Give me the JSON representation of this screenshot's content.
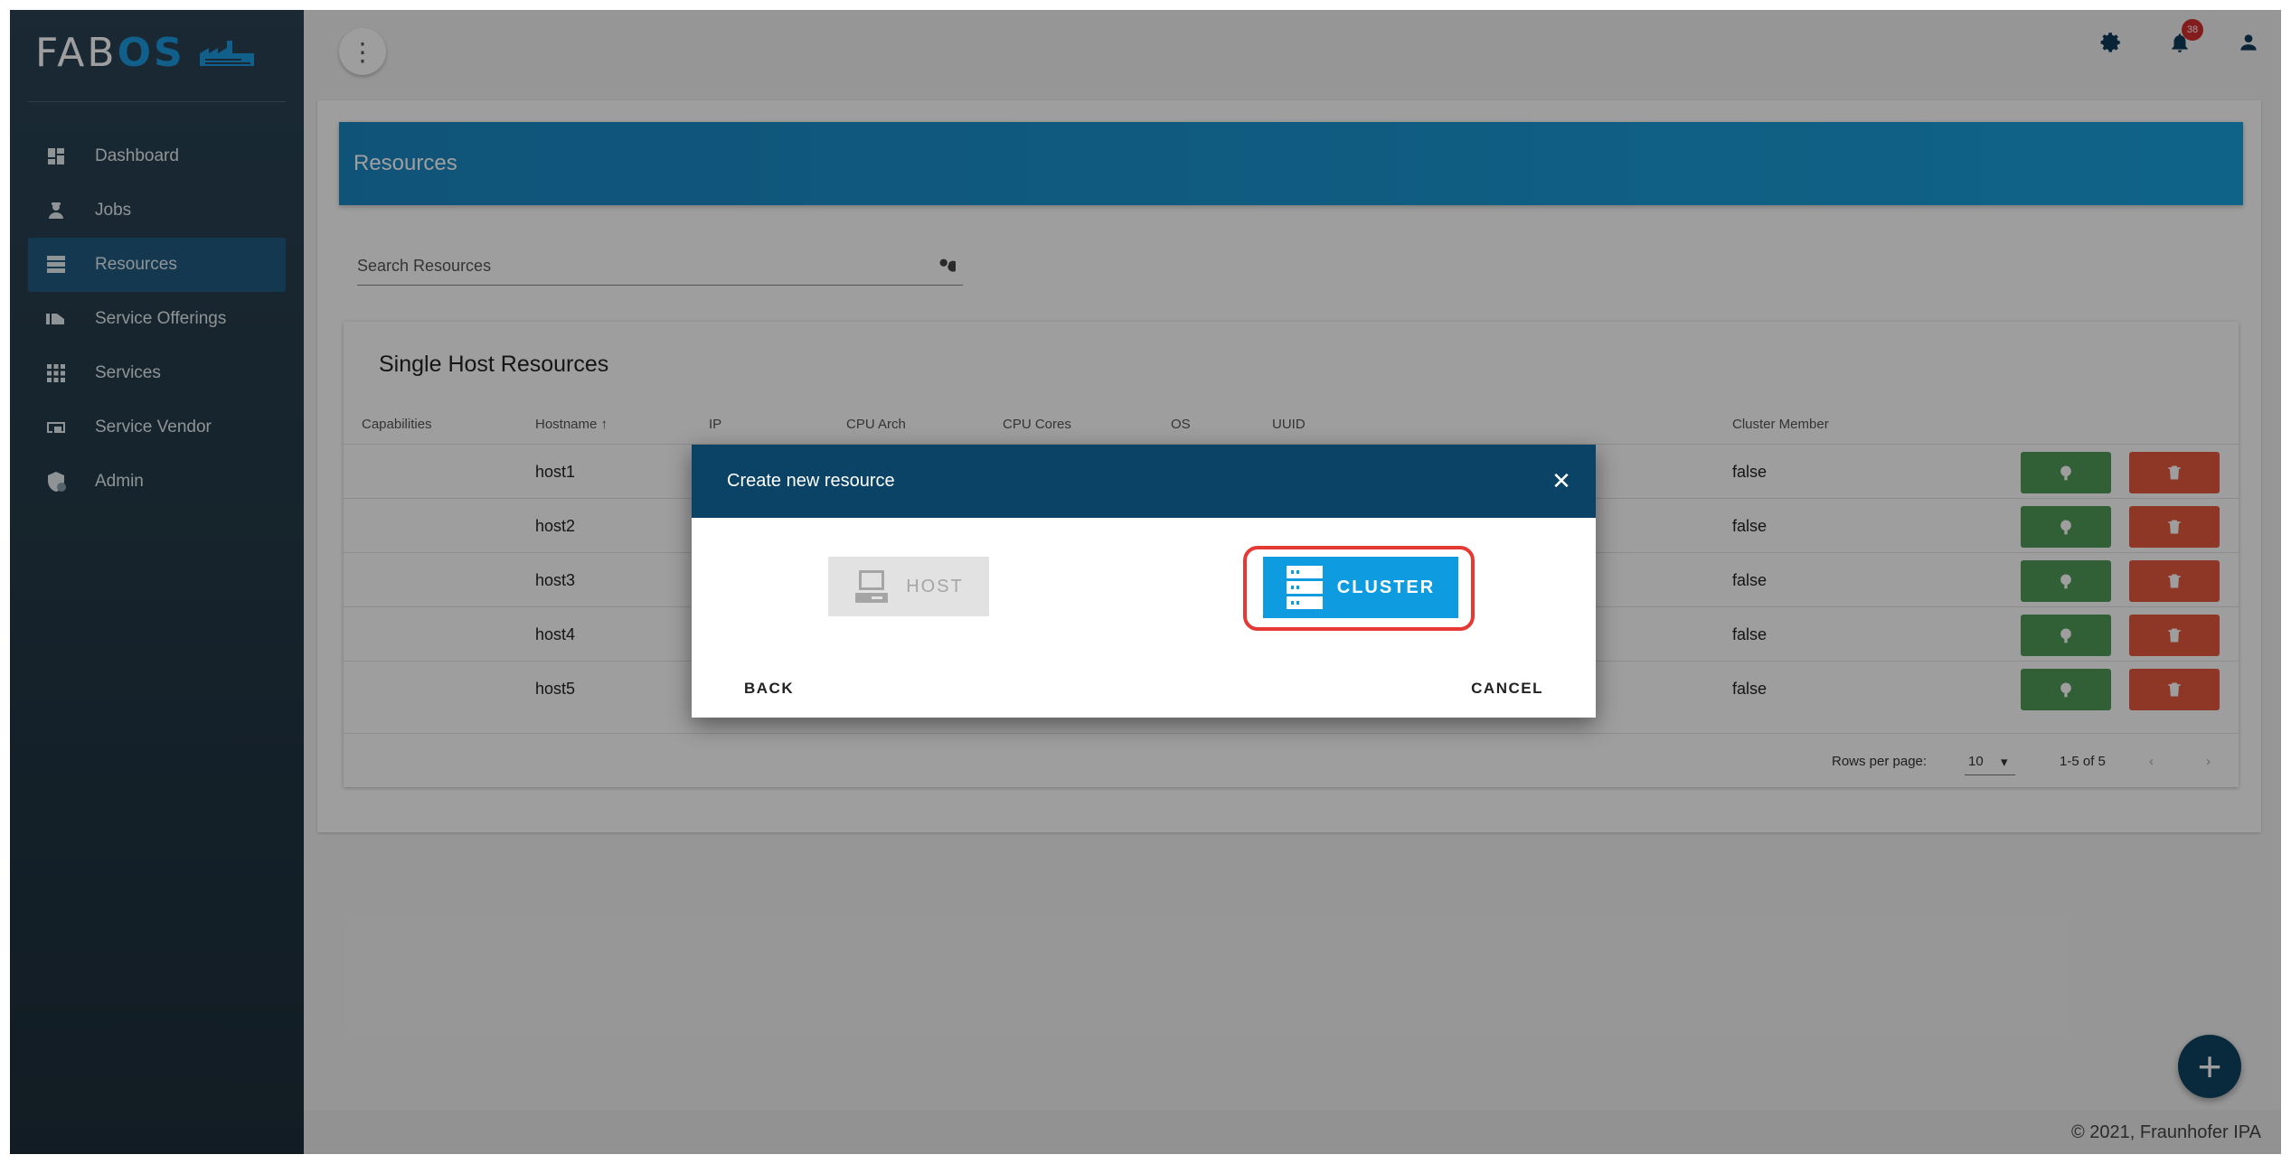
{
  "app": {
    "logo_main": "FAB",
    "logo_accent": "OS"
  },
  "sidebar": {
    "items": [
      {
        "label": "Dashboard",
        "icon": "dashboard-icon"
      },
      {
        "label": "Jobs",
        "icon": "worker-icon"
      },
      {
        "label": "Resources",
        "icon": "server-icon",
        "active": true
      },
      {
        "label": "Service Offerings",
        "icon": "offerings-icon"
      },
      {
        "label": "Services",
        "icon": "apps-grid-icon"
      },
      {
        "label": "Service Vendor",
        "icon": "vendor-icon"
      },
      {
        "label": "Admin",
        "icon": "admin-shield-icon"
      }
    ]
  },
  "topbar": {
    "notification_count": "38"
  },
  "page": {
    "title": "Resources",
    "search_placeholder": "Search Resources"
  },
  "table": {
    "title": "Single Host Resources",
    "columns": [
      "Capabilities",
      "Hostname",
      "IP",
      "CPU Arch",
      "CPU Cores",
      "OS",
      "UUID",
      "Cluster Member"
    ],
    "rows": [
      {
        "hostname": "host1",
        "cluster_member": "false"
      },
      {
        "hostname": "host2",
        "cluster_member": "false"
      },
      {
        "hostname": "host3",
        "cluster_member": "false"
      },
      {
        "hostname": "host4",
        "cluster_member": "false"
      },
      {
        "hostname": "host5",
        "cluster_member": "false"
      }
    ],
    "pagination": {
      "rows_per_page_label": "Rows per page:",
      "rows_per_page": "10",
      "range": "1-5 of 5"
    }
  },
  "footer": {
    "text": "© 2021, Fraunhofer IPA"
  },
  "modal": {
    "title": "Create new resource",
    "host_label": "HOST",
    "cluster_label": "CLUSTER",
    "back_label": "BACK",
    "cancel_label": "CANCEL"
  },
  "colors": {
    "sidebar": "#2a4354",
    "active_nav": "#1f5b80",
    "banner": "#1ba1dc",
    "modal_header": "#0a4366",
    "cluster_button": "#0f9be0",
    "highlight": "#e53935",
    "edit_button": "#4f9c57",
    "delete_button": "#e55a3f"
  }
}
